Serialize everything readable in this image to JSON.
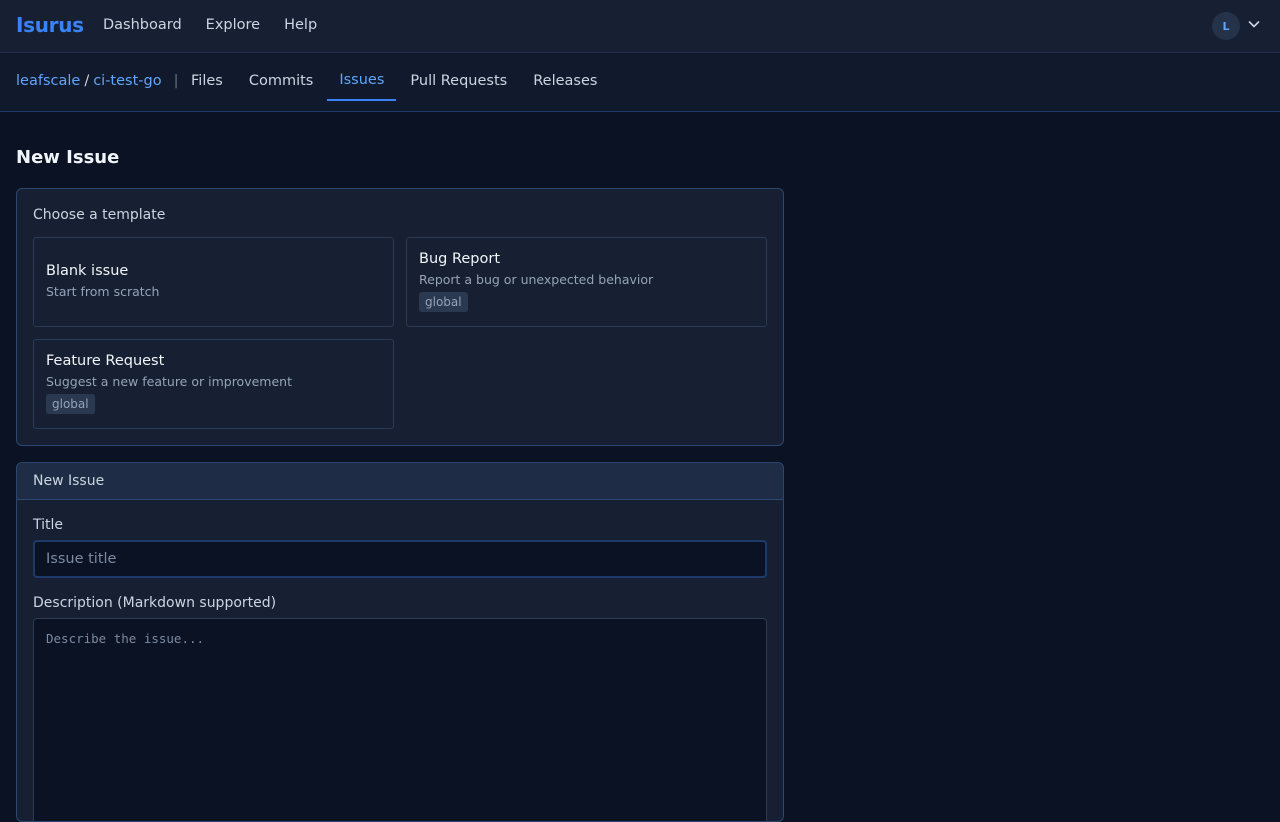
{
  "app": {
    "brand": "Isurus"
  },
  "topnav": [
    "Dashboard",
    "Explore",
    "Help"
  ],
  "user": {
    "initial": "L"
  },
  "repo": {
    "owner": "leafscale",
    "separator": "/",
    "name": "ci-test-go",
    "pipe": "|"
  },
  "tabs": [
    "Files",
    "Commits",
    "Issues",
    "Pull Requests",
    "Releases"
  ],
  "active_tab": "Issues",
  "page": {
    "title": "New Issue"
  },
  "templates": {
    "heading": "Choose a template",
    "items": [
      {
        "name": "Blank issue",
        "desc": "Start from scratch",
        "badge": ""
      },
      {
        "name": "Bug Report",
        "desc": "Report a bug or unexpected behavior",
        "badge": "global"
      },
      {
        "name": "Feature Request",
        "desc": "Suggest a new feature or improvement",
        "badge": "global"
      }
    ]
  },
  "form": {
    "header": "New Issue",
    "title_label": "Title",
    "title_placeholder": "Issue title",
    "title_value": "",
    "desc_label": "Description (Markdown supported)",
    "desc_placeholder": "Describe the issue...",
    "desc_value": ""
  },
  "colors": {
    "accent": "#3b82f6",
    "background": "#0b1224",
    "panel": "#162032"
  }
}
